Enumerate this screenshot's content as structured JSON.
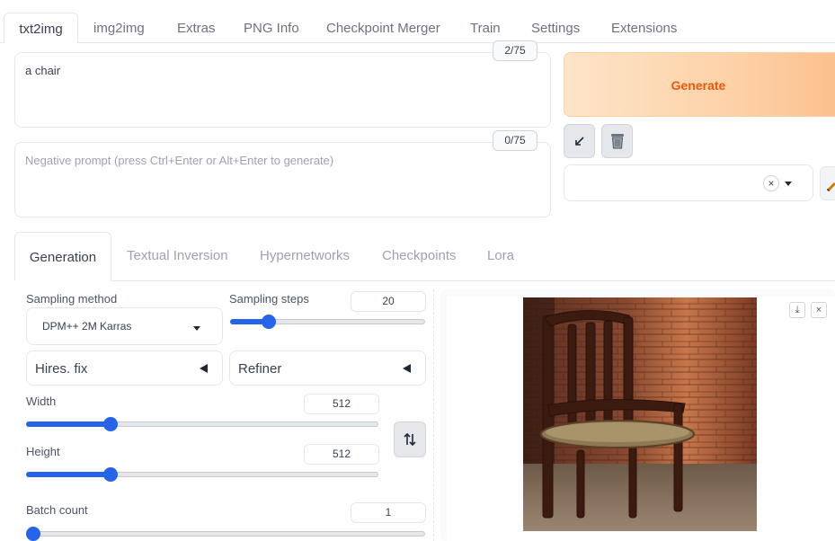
{
  "top_tabs": [
    "txt2img",
    "img2img",
    "Extras",
    "PNG Info",
    "Checkpoint Merger",
    "Train",
    "Settings",
    "Extensions"
  ],
  "prompt": {
    "value": "a chair",
    "token_count": "2/75"
  },
  "negative_prompt": {
    "placeholder": "Negative prompt (press Ctrl+Enter or Alt+Enter to generate)",
    "token_count": "0/75"
  },
  "generate": {
    "label": "Generate"
  },
  "tools": {
    "read_params_icon": "arrow-diagonal-icon",
    "trash_icon": "trash-icon",
    "clear_glyph": "×"
  },
  "sub_tabs": [
    "Generation",
    "Textual Inversion",
    "Hypernetworks",
    "Checkpoints",
    "Lora"
  ],
  "sampling": {
    "method_label": "Sampling method",
    "method_value": "DPM++ 2M Karras",
    "steps_label": "Sampling steps",
    "steps_value": "20",
    "steps_fraction": 0.2
  },
  "accordions": {
    "hires": "Hires. fix",
    "refiner": "Refiner"
  },
  "width": {
    "label": "Width",
    "value": "512",
    "fraction": 0.24
  },
  "height": {
    "label": "Height",
    "value": "512",
    "fraction": 0.24
  },
  "batch_count": {
    "label": "Batch count",
    "value": "1",
    "fraction": 0.0
  },
  "output": {
    "download_glyph": "⤓",
    "close_glyph": "×"
  },
  "colors": {
    "accent": "#2563eb",
    "generate_text": "#ea580c"
  }
}
